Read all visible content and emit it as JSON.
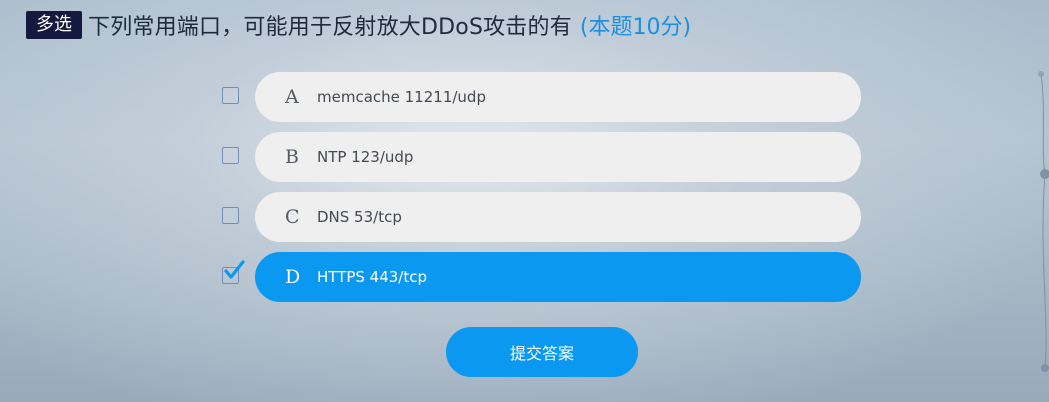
{
  "question": {
    "type_badge": "多选",
    "text": "下列常用端口，可能用于反射放大DDoS攻击的有",
    "score": "(本题10分)"
  },
  "options": [
    {
      "letter": "A",
      "text": "memcache 11211/udp",
      "checked": false
    },
    {
      "letter": "B",
      "text": "NTP 123/udp",
      "checked": false
    },
    {
      "letter": "C",
      "text": "DNS 53/tcp",
      "checked": false
    },
    {
      "letter": "D",
      "text": "HTTPS 443/tcp",
      "checked": true
    }
  ],
  "submit_label": "提交答案",
  "colors": {
    "accent": "#0b98f0",
    "badge": "#15183f",
    "score": "#1d8fe0",
    "option_bg": "#efeff0"
  }
}
